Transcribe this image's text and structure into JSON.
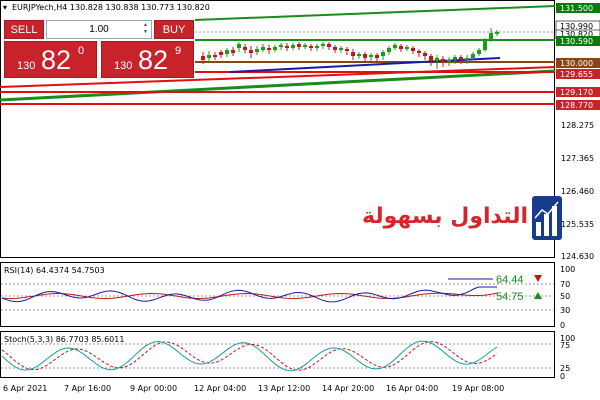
{
  "chart_header": {
    "symbol_line": "EURJPYech,H4  130.828 130.838 130.773 130.820"
  },
  "trade_panel": {
    "sell_label": "SELL",
    "buy_label": "BUY",
    "lot_value": "1.00",
    "sell_quote": {
      "small": "130",
      "big": "82",
      "sup": "0"
    },
    "buy_quote": {
      "small": "130",
      "big": "82",
      "sup": "9"
    }
  },
  "watermark": {
    "text": "التداول بسهولة"
  },
  "colors": {
    "green_line": "#1a8c1a",
    "red_line": "#e01010",
    "blue_line": "#1a1aa8",
    "brown_line": "#8b4513",
    "bull_candle": "#16a016",
    "bear_candle": "#c01818",
    "price_box_green": "#0c7a0c",
    "price_box_red": "#c8232b",
    "rsi_line": "#1a1aa8",
    "rsi_signal": "#c01818",
    "stoch_main": "#1a9aa8",
    "stoch_signal": "#c01818"
  },
  "price_axis": {
    "labels": [
      "128.275",
      "127.365",
      "126.460",
      "125.535",
      "124.630"
    ],
    "boxes": [
      {
        "text": "131.500",
        "type": "green"
      },
      {
        "text": "130.990",
        "type": "white"
      },
      {
        "text": "130.820",
        "type": "white"
      },
      {
        "text": "130.590",
        "type": "green"
      },
      {
        "text": "130.000",
        "type": "brown"
      },
      {
        "text": "129.655",
        "type": "red"
      },
      {
        "text": "129.170",
        "type": "red"
      },
      {
        "text": "128.770",
        "type": "red"
      }
    ]
  },
  "rsi_panel": {
    "header": "RSI(14) 64.4374 54.7503",
    "axis_labels": [
      "100",
      "70",
      "50",
      "30",
      "0"
    ],
    "value_main": "64.44",
    "value_signal": "54.75"
  },
  "stoch_panel": {
    "header": "Stoch(5,3,3) 86.7703 85.6011",
    "axis_labels": [
      "100",
      "75",
      "25",
      "0"
    ]
  },
  "time_axis": {
    "labels": [
      "6 Apr 2021",
      "7 Apr 16:00",
      "9 Apr 00:00",
      "12 Apr 04:00",
      "13 Apr 12:00",
      "14 Apr 20:00",
      "16 Apr 04:00",
      "19 Apr 08:00"
    ]
  }
}
